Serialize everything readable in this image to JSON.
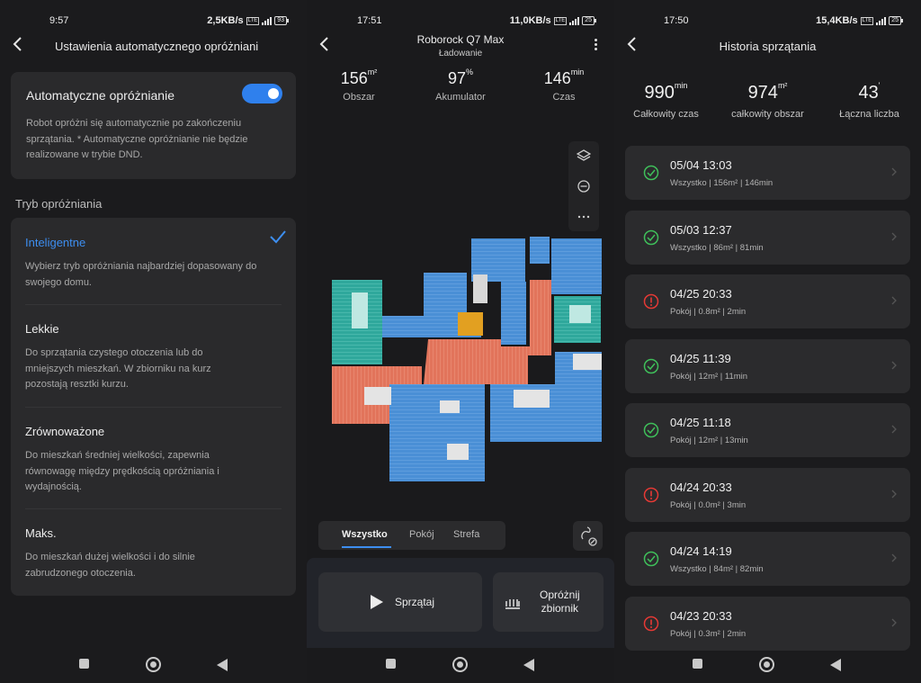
{
  "panel1": {
    "status": {
      "time": "9:57",
      "speed": "2,5KB/s",
      "battery": "93"
    },
    "header": {
      "title": "Ustawienia automatycznego opróżniani"
    },
    "auto": {
      "title": "Automatyczne opróżnianie",
      "enabled": true,
      "description": "Robot opróżni się automatycznie po zakończeniu sprzątania. * Automatyczne opróżnianie nie będzie realizowane w trybie DND."
    },
    "section_label": "Tryb opróżniania",
    "modes": [
      {
        "title": "Inteligentne",
        "selected": true,
        "description": "Wybierz tryb opróżniania najbardziej dopasowany do swojego domu."
      },
      {
        "title": "Lekkie",
        "selected": false,
        "description": "Do sprzątania czystego otoczenia lub do mniejszych mieszkań. W zbiorniku na kurz pozostają resztki kurzu."
      },
      {
        "title": "Zrównoważone",
        "selected": false,
        "description": "Do mieszkań średniej wielkości, zapewnia równowagę między prędkością opróżniania i wydajnością."
      },
      {
        "title": "Maks.",
        "selected": false,
        "description": "Do mieszkań dużej wielkości i do silnie zabrudzonego otoczenia."
      }
    ]
  },
  "panel2": {
    "status": {
      "time": "17:51",
      "speed": "11,0KB/s",
      "battery": "25"
    },
    "robot_name": "Roborock Q7 Max",
    "robot_status": "Ładowanie",
    "stats": [
      {
        "value": "156",
        "unit": "m²",
        "label": "Obszar"
      },
      {
        "value": "97",
        "unit": "%",
        "label": "Akumulator"
      },
      {
        "value": "146",
        "unit": "min",
        "label": "Czas"
      }
    ],
    "tabs": [
      "Wszystko",
      "Pokój",
      "Strefa"
    ],
    "active_tab": "Wszystko",
    "clean_button": "Sprzątaj",
    "empty_button_line1": "Opróżnij",
    "empty_button_line2": "zbiornik",
    "map_colors": {
      "blue": "#4a8fd6",
      "teal": "#2fa89c",
      "orange": "#e2745b",
      "yellow": "#e2a021"
    }
  },
  "panel3": {
    "status": {
      "time": "17:50",
      "speed": "15,4KB/s",
      "battery": "25"
    },
    "title": "Historia sprzątania",
    "totals": [
      {
        "value": "990",
        "unit": "min",
        "label": "Całkowity czas"
      },
      {
        "value": "974",
        "unit": "m²",
        "label": "całkowity obszar"
      },
      {
        "value": "43",
        "unit": "'",
        "label": "Łączna liczba"
      }
    ],
    "records": [
      {
        "date": "05/04 13:03",
        "info": "Wszystko | 156m² | 146min",
        "status": "ok"
      },
      {
        "date": "05/03 12:37",
        "info": "Wszystko | 86m² | 81min",
        "status": "ok"
      },
      {
        "date": "04/25 20:33",
        "info": "Pokój | 0.8m² | 2min",
        "status": "error"
      },
      {
        "date": "04/25 11:39",
        "info": "Pokój | 12m² | 11min",
        "status": "ok"
      },
      {
        "date": "04/25 11:18",
        "info": "Pokój | 12m² | 13min",
        "status": "ok"
      },
      {
        "date": "04/24 20:33",
        "info": "Pokój | 0.0m² | 3min",
        "status": "error"
      },
      {
        "date": "04/24 14:19",
        "info": "Wszystko | 84m² | 82min",
        "status": "ok"
      },
      {
        "date": "04/23 20:33",
        "info": "Pokój | 0.3m² | 2min",
        "status": "error"
      }
    ],
    "colors": {
      "ok": "#3fbf5a",
      "error": "#e53935"
    }
  }
}
